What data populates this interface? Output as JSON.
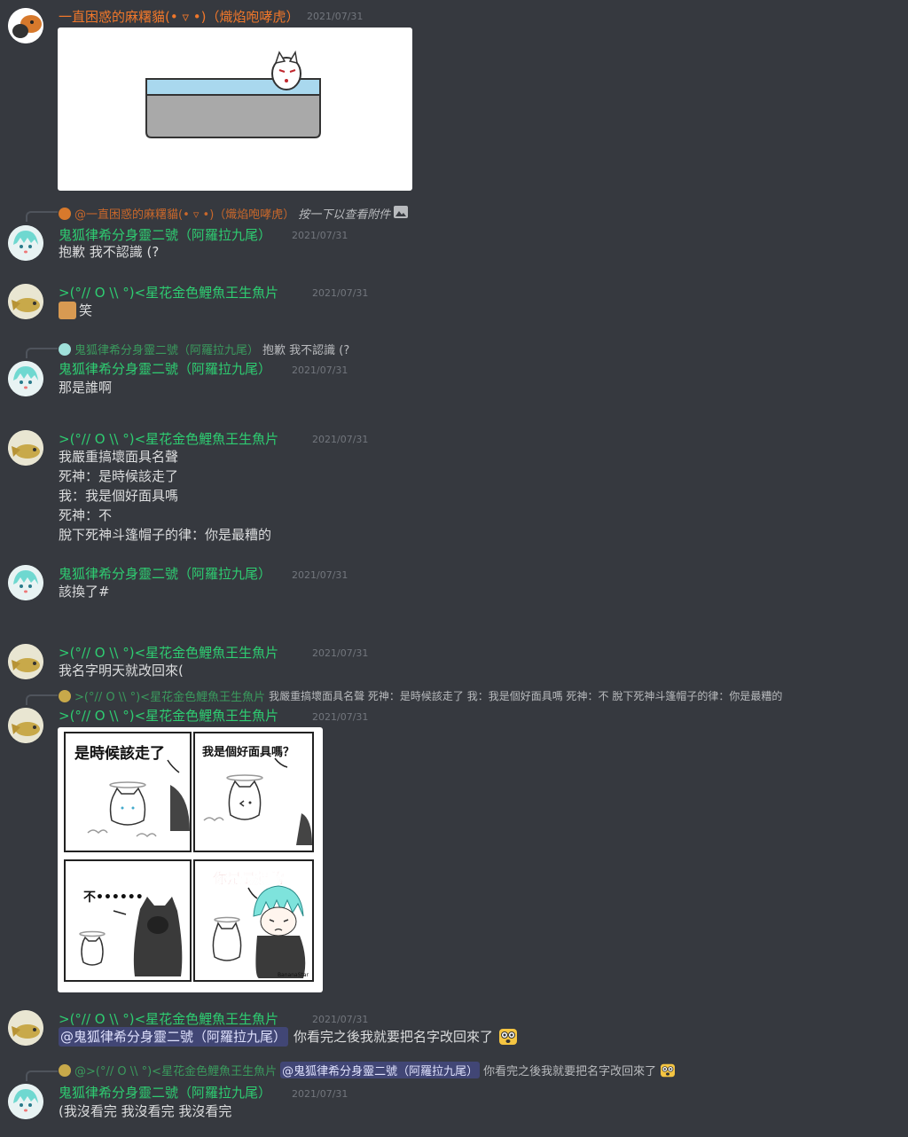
{
  "messages": [
    {
      "author": "一直困惑的麻糬貓(• ▿ •)（熾焰咆哮虎）",
      "time": "2021/07/31"
    },
    {
      "reply_author": "@一直困惑的麻糬貓(• ▿ •)（熾焰咆哮虎）",
      "reply_text": "按一下以查看附件",
      "author": "鬼狐律希分身靈二號（阿羅拉九尾）",
      "time": "2021/07/31",
      "text": "抱歉 我不認識 (?"
    },
    {
      "author": ">(°// O \\\\ °)<星花金色鯉魚王生魚片",
      "time": "2021/07/31",
      "text": "笑"
    },
    {
      "reply_author": "鬼狐律希分身靈二號（阿羅拉九尾）",
      "reply_text": "抱歉 我不認識 (?",
      "author": "鬼狐律希分身靈二號（阿羅拉九尾）",
      "time": "2021/07/31",
      "text": "那是誰啊"
    },
    {
      "author": ">(°// O \\\\ °)<星花金色鯉魚王生魚片",
      "time": "2021/07/31",
      "lines": [
        "我嚴重搞壞面具名聲",
        "死神：是時候該走了",
        "我：我是個好面具嗎",
        "死神：不",
        "脫下死神斗篷帽子的律：你是最糟的"
      ]
    },
    {
      "author": "鬼狐律希分身靈二號（阿羅拉九尾）",
      "time": "2021/07/31",
      "text": "該換了#"
    },
    {
      "author": ">(°// O \\\\ °)<星花金色鯉魚王生魚片",
      "time": "2021/07/31",
      "text": "我名字明天就改回來("
    },
    {
      "reply_author": ">(°// O \\\\ °)<星花金色鯉魚王生魚片",
      "reply_text": "我嚴重搞壞面具名聲 死神：是時候該走了 我：我是個好面具嗎 死神：不 脫下死神斗篷帽子的律：你是最糟的",
      "author": ">(°// O \\\\ °)<星花金色鯉魚王生魚片",
      "time": "2021/07/31"
    },
    {
      "author": ">(°// O \\\\ °)<星花金色鯉魚王生魚片",
      "time": "2021/07/31",
      "mention": "@鬼狐律希分身靈二號（阿羅拉九尾）",
      "text": "你看完之後我就要把名字改回來了"
    },
    {
      "reply_author": "@>(°// O \\\\ °)<星花金色鯉魚王生魚片",
      "reply_mention": "@鬼狐律希分身靈二號（阿羅拉九尾）",
      "reply_text": "你看完之後我就要把名字改回來了",
      "author": "鬼狐律希分身靈二號（阿羅拉九尾）",
      "time": "2021/07/31",
      "text": "(我沒看完 我沒看完 我沒看完"
    }
  ],
  "comic": {
    "panel1": "是時候該走了",
    "panel2": "我是個好面具嗎？",
    "panel3": "不••••••",
    "panel4": "你是最爛的",
    "signature": "BananaStar"
  },
  "colors": {
    "background": "#36393f",
    "username_green": "#2ecc71",
    "username_orange": "#f0772a",
    "timestamp": "#72767d",
    "mention_bg": "#414675"
  },
  "icons": {
    "image_attachment": "image-icon",
    "emoji": "shocked-face-emoji"
  }
}
